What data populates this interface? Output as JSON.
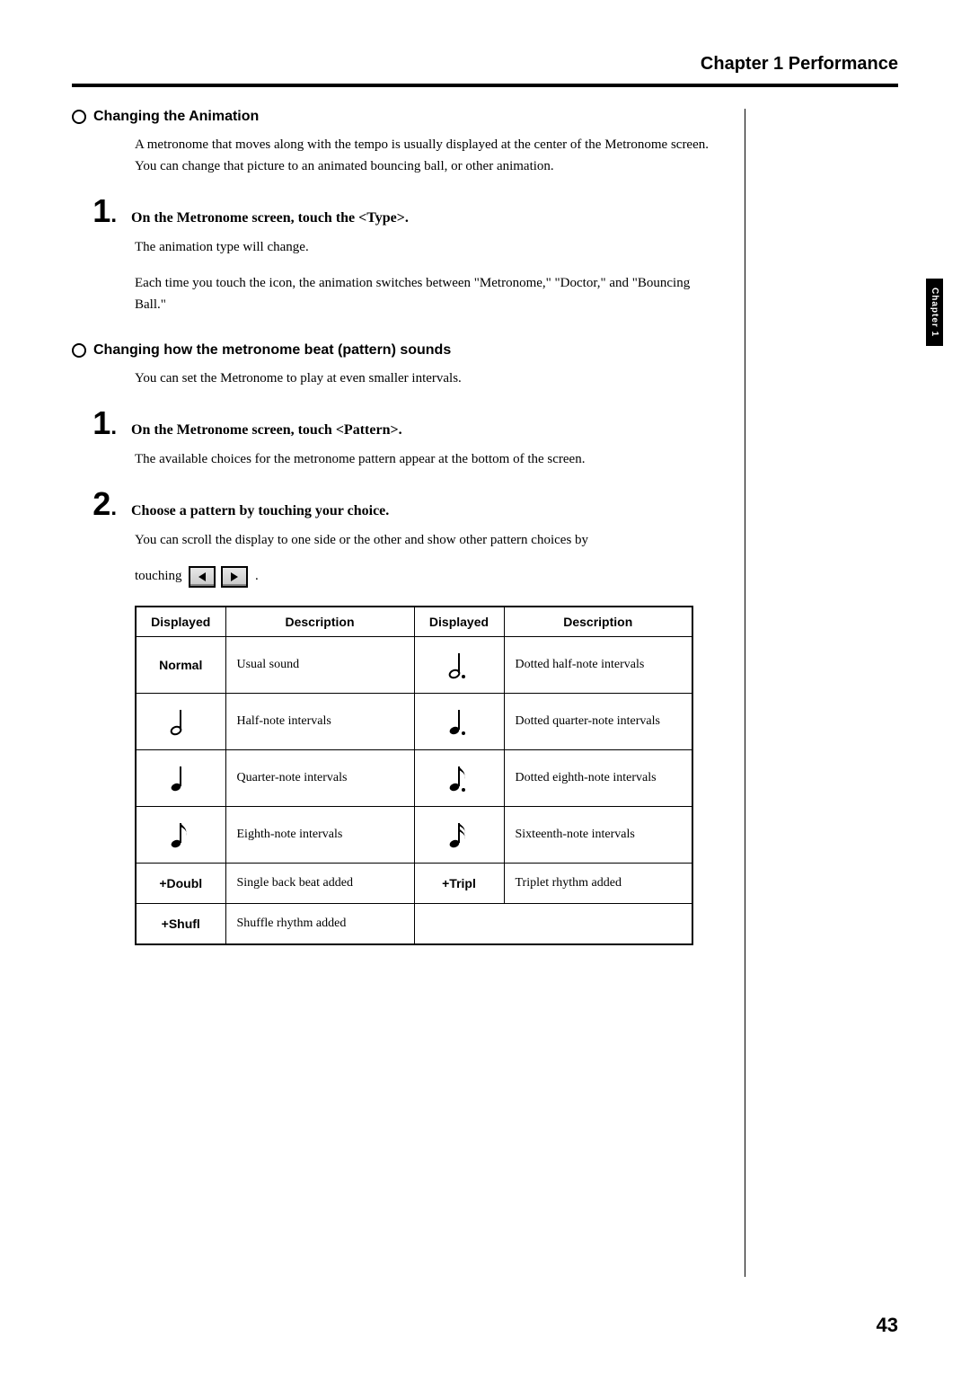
{
  "header": {
    "chapter": "Chapter 1 Performance"
  },
  "sideTab": "Chapter 1",
  "sections": {
    "changingAnimation": {
      "heading": "Changing the Animation",
      "intro": "A metronome that moves along with the tempo is usually displayed at the center of the Metronome screen. You can change that picture to an animated bouncing ball, or other animation.",
      "step1": {
        "text": "On the Metronome screen, touch the <Type>.",
        "body1": "The animation type will change.",
        "body2": "Each time you touch the icon, the animation switches between \"Metronome,\" \"Doctor,\" and \"Bouncing Ball.\""
      }
    },
    "changingPattern": {
      "heading": "Changing how the metronome beat (pattern) sounds",
      "intro": "You can set the Metronome to play at even smaller intervals.",
      "step1": {
        "text": "On the Metronome screen, touch <Pattern>.",
        "body": "The available choices for the metronome pattern appear at the bottom of the screen."
      },
      "step2": {
        "text": "Choose a pattern by touching your choice.",
        "scrollPrefix": "You can scroll the display to one side or the other and show other pattern choices by",
        "scrollSuffix": "touching",
        "scrollEnd": "."
      }
    }
  },
  "table": {
    "headers": {
      "displayed": "Displayed",
      "description": "Description"
    },
    "rows": [
      {
        "col1": "Normal",
        "col1Type": "text",
        "desc1": "Usual sound",
        "col2": "dotted-half",
        "col2Type": "note",
        "desc2": "Dotted half-note intervals"
      },
      {
        "col1": "half",
        "col1Type": "note",
        "desc1": "Half-note intervals",
        "col2": "dotted-quarter",
        "col2Type": "note",
        "desc2": "Dotted quarter-note intervals"
      },
      {
        "col1": "quarter",
        "col1Type": "note",
        "desc1": "Quarter-note intervals",
        "col2": "dotted-eighth",
        "col2Type": "note",
        "desc2": "Dotted eighth-note intervals"
      },
      {
        "col1": "eighth",
        "col1Type": "note",
        "desc1": "Eighth-note intervals",
        "col2": "sixteenth",
        "col2Type": "note",
        "desc2": "Sixteenth-note intervals"
      },
      {
        "col1": "+Doubl",
        "col1Type": "text",
        "desc1": "Single back beat added",
        "col2": "+Tripl",
        "col2Type": "text",
        "desc2": "Triplet rhythm added"
      },
      {
        "col1": "+Shufl",
        "col1Type": "text",
        "desc1": "Shuffle rhythm added",
        "col2": "",
        "col2Type": "empty",
        "desc2": ""
      }
    ]
  },
  "pageNumber": "43"
}
